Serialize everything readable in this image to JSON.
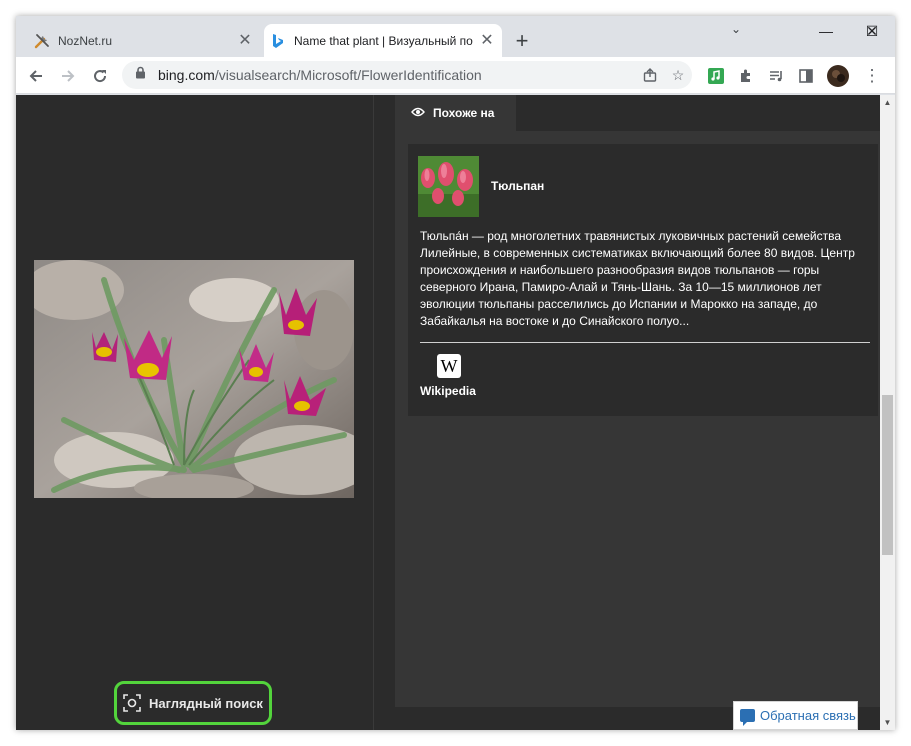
{
  "browser": {
    "tabs": [
      {
        "title": "NozNet.ru",
        "icon": "tools-icon"
      },
      {
        "title": "Name that plant | Визуальный по",
        "icon": "bing-icon"
      }
    ],
    "url_host": "bing.com",
    "url_path": "/visualsearch/Microsoft/FlowerIdentification"
  },
  "page": {
    "visual_search_label": "Наглядный поиск",
    "right_tab_label": "Похоже на",
    "result": {
      "title": "Тюльпан",
      "description": "Тюльпа́н — род многолетних травянистых луковичных растений семейства Лилейные, в современных систематиках включающий более 80 видов. Центр происхождения и наибольшего разнообразия видов тюльпанов — горы северного Ирана, Памиро-Алай и Тянь-Шань. За 10—15 миллионов лет эволюции тюльпаны расселились до Испании и Марокко на западе, до Забайкалья на востоке и до Синайского полуо...",
      "source_logo": "W",
      "source_label": "Wikipedia"
    },
    "feedback_label": "Обратная связь"
  },
  "colors": {
    "background": "#2b2b2b",
    "panel": "#363636",
    "highlight": "#53d43c",
    "feedback": "#2b6fb3"
  }
}
